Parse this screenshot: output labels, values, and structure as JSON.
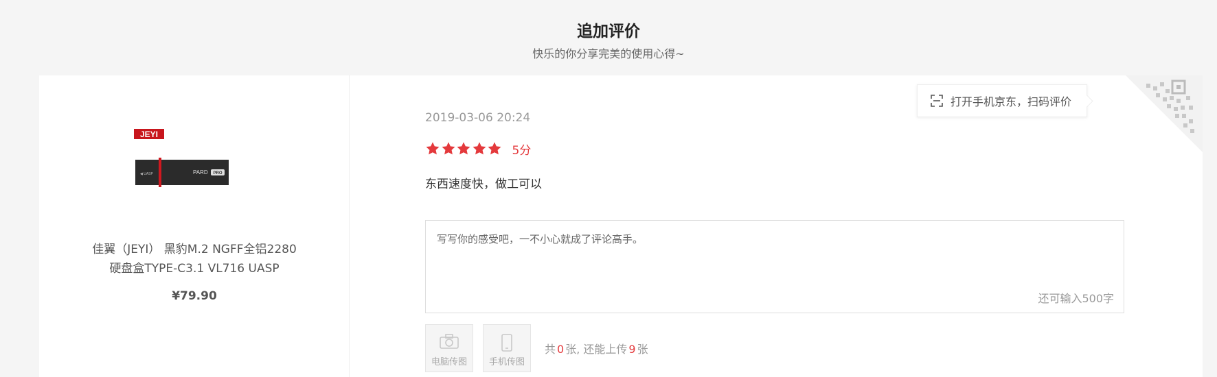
{
  "header": {
    "title": "追加评价",
    "subtitle": "快乐的你分享完美的使用心得~"
  },
  "product": {
    "brand_logo_text": "JEYI",
    "device_text": "PARD",
    "device_badge": "PRO",
    "name_line1": "佳翼（JEYI） 黑豹M.2 NGFF全铝2280",
    "name_line2": "硬盘盒TYPE-C3.1 VL716 UASP",
    "price": "¥79.90"
  },
  "review": {
    "date": "2019-03-06 20:24",
    "rating": 5,
    "score_label": "5分",
    "text": "东西速度快，做工可以"
  },
  "qr": {
    "tip_text": "打开手机京东，扫码评价",
    "icon": "scan-icon"
  },
  "comment": {
    "placeholder": "写写你的感受吧，一不小心就成了评论高手。",
    "char_count": "还可输入500字"
  },
  "upload": {
    "pc_label": "电脑传图",
    "mobile_label": "手机传图",
    "prefix": "共",
    "count": "0",
    "middle": "张, 还能上传",
    "remaining": "9",
    "suffix": "张"
  },
  "colors": {
    "accent": "#e4393c",
    "background": "#f5f5f5",
    "panel": "#ffffff"
  }
}
